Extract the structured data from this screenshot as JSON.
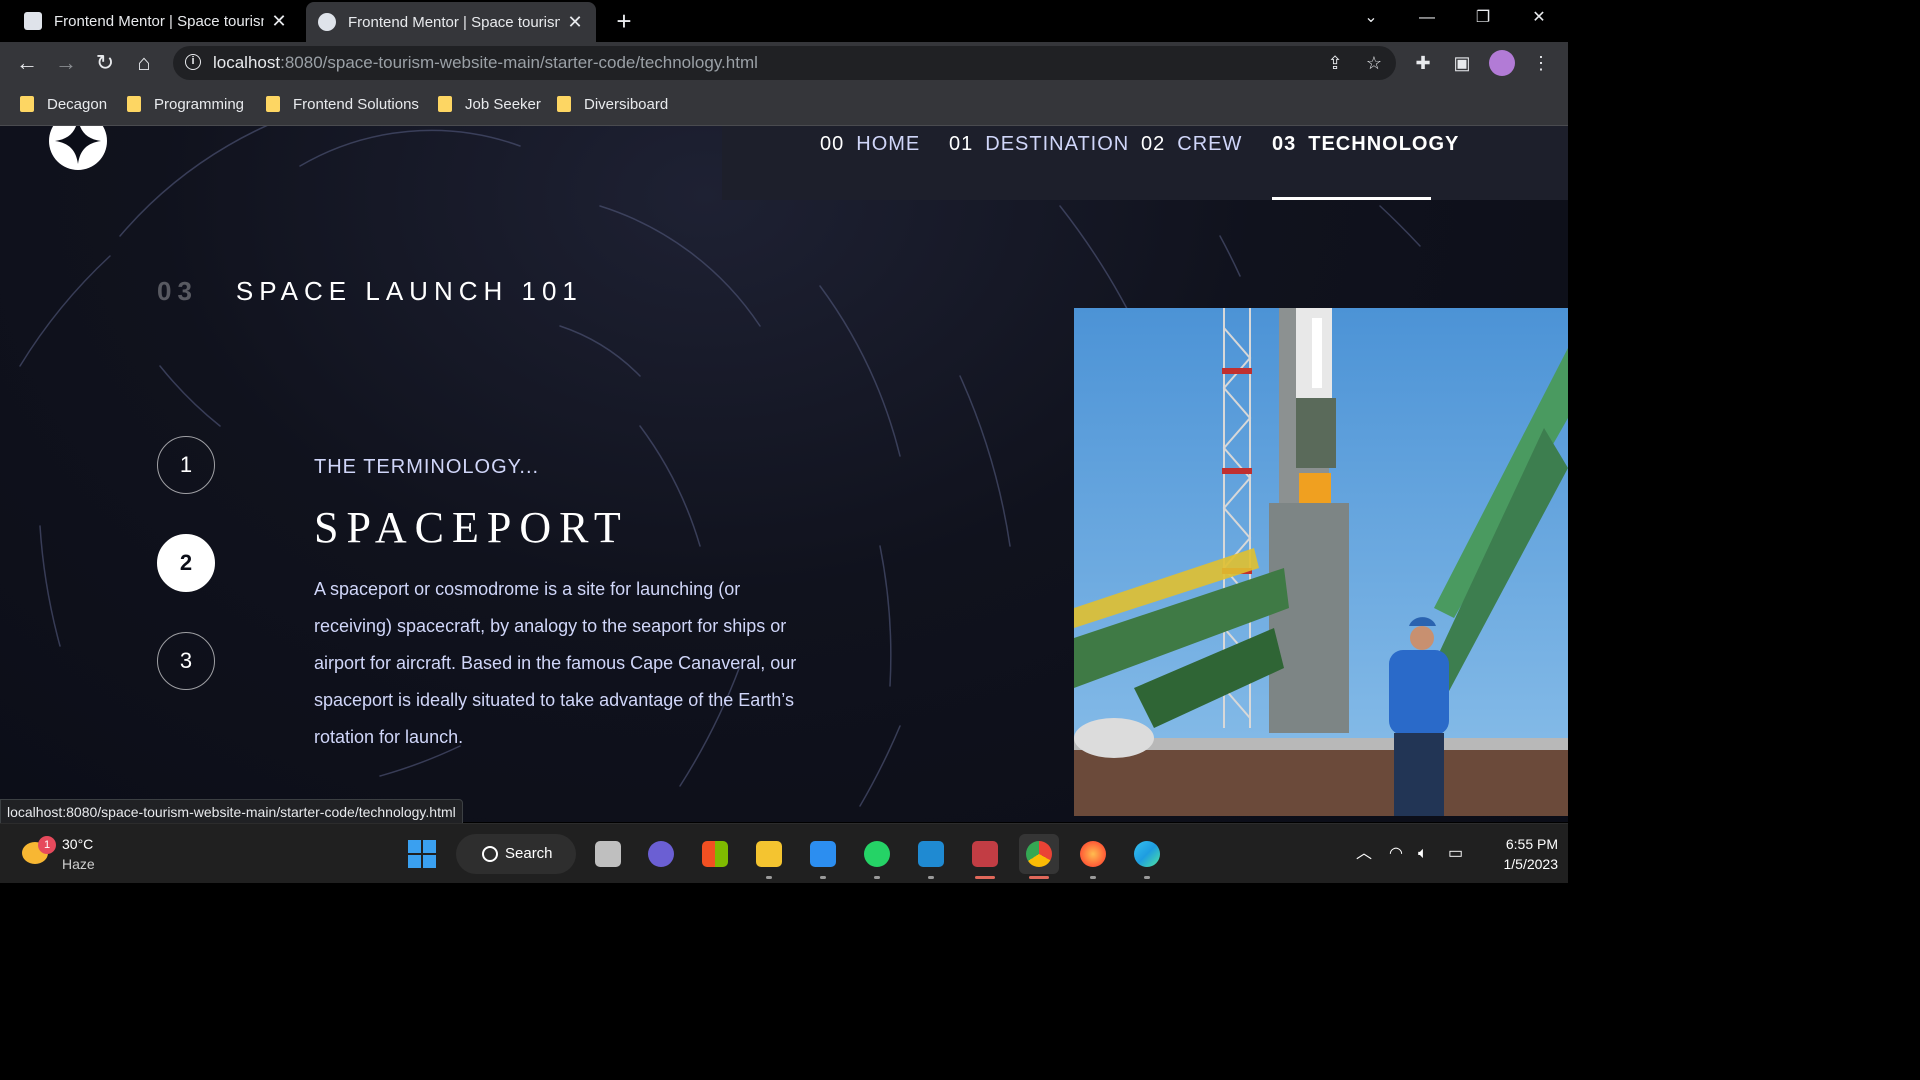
{
  "browser": {
    "tabs": [
      {
        "title": "Frontend Mentor | Space tourism"
      },
      {
        "title": "Frontend Mentor | Space tourism"
      }
    ],
    "url_host": "localhost",
    "url_path": ":8080/space-tourism-website-main/starter-code/technology.html",
    "bookmarks": [
      "Decagon",
      "Programming",
      "Frontend Solutions",
      "Job Seeker",
      "Diversiboard"
    ],
    "status_url": "localhost:8080/space-tourism-website-main/starter-code/technology.html"
  },
  "site": {
    "nav": [
      {
        "num": "00",
        "label": "HOME",
        "active": false
      },
      {
        "num": "01",
        "label": "DESTINATION",
        "active": false
      },
      {
        "num": "02",
        "label": "CREW",
        "active": false
      },
      {
        "num": "03",
        "label": "TECHNOLOGY",
        "active": true
      }
    ],
    "heading_num": "03",
    "heading": "SPACE LAUNCH 101",
    "steps": [
      "1",
      "2",
      "3"
    ],
    "active_step": "2",
    "terminology": "THE TERMINOLOGY...",
    "title": "SPACEPORT",
    "description": "A spaceport or cosmodrome is a site for launching (or receiving) spacecraft, by analogy to the seaport for ships or airport for aircraft. Based in the famous Cape Canaveral, our spaceport is ideally situated to take advantage of the Earth’s rotation for launch."
  },
  "taskbar": {
    "weather_temp": "30°C",
    "weather_desc": "Haze",
    "weather_badge": "1",
    "search_label": "Search",
    "time": "6:55 PM",
    "date": "1/5/2023"
  },
  "colors": {
    "page_bg": "#0b0d17",
    "nav_bg": "#1d1f2b",
    "accent_text": "#d0d6f9"
  }
}
